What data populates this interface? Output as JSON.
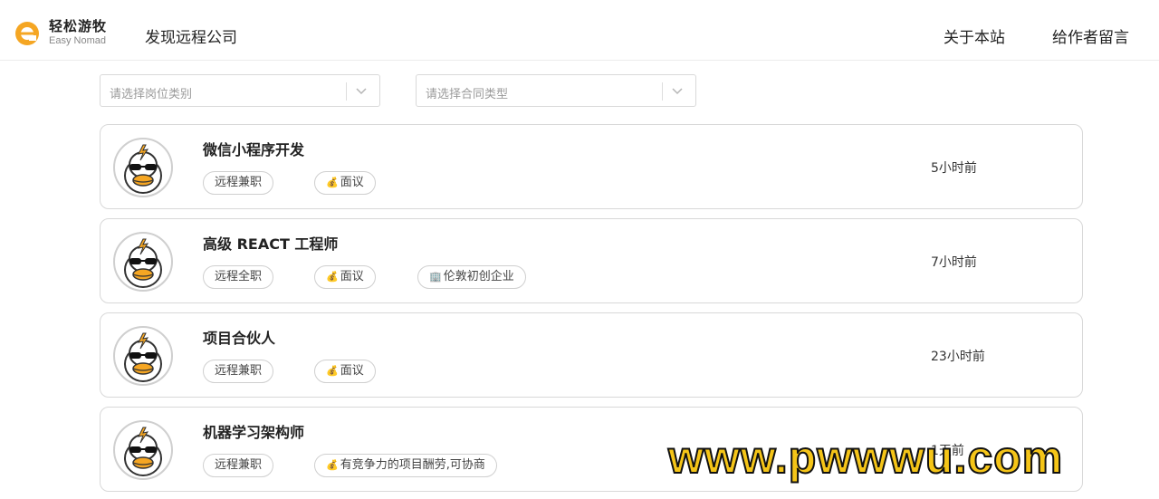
{
  "header": {
    "logo_cn": "轻松游牧",
    "logo_en": "Easy Nomad",
    "discover": "发现远程公司",
    "about": "关于本站",
    "message": "给作者留言"
  },
  "filters": {
    "job_category_placeholder": "请选择岗位类别",
    "contract_type_placeholder": "请选择合同类型"
  },
  "jobs": [
    {
      "title": "微信小程序开发",
      "time": "5小时前",
      "tags": [
        {
          "label": "远程兼职",
          "icon": ""
        },
        {
          "label": "面议",
          "icon": "money-bag-icon"
        }
      ]
    },
    {
      "title": "高级 REACT 工程师",
      "time": "7小时前",
      "tags": [
        {
          "label": "远程全职",
          "icon": ""
        },
        {
          "label": "面议",
          "icon": "money-bag-icon"
        },
        {
          "label": "伦敦初创企业",
          "icon": "building-icon"
        }
      ]
    },
    {
      "title": "项目合伙人",
      "time": "23小时前",
      "tags": [
        {
          "label": "远程兼职",
          "icon": ""
        },
        {
          "label": "面议",
          "icon": "money-bag-icon"
        }
      ]
    },
    {
      "title": "机器学习架构师",
      "time": "1天前",
      "tags": [
        {
          "label": "远程兼职",
          "icon": ""
        },
        {
          "label": "有竞争力的项目酬劳,可协商",
          "icon": "money-bag-icon"
        }
      ]
    }
  ],
  "watermark": "www.pwwwu.com",
  "colors": {
    "accent": "#f5a623",
    "border": "#d8d8d8",
    "watermark": "#f5c518"
  }
}
